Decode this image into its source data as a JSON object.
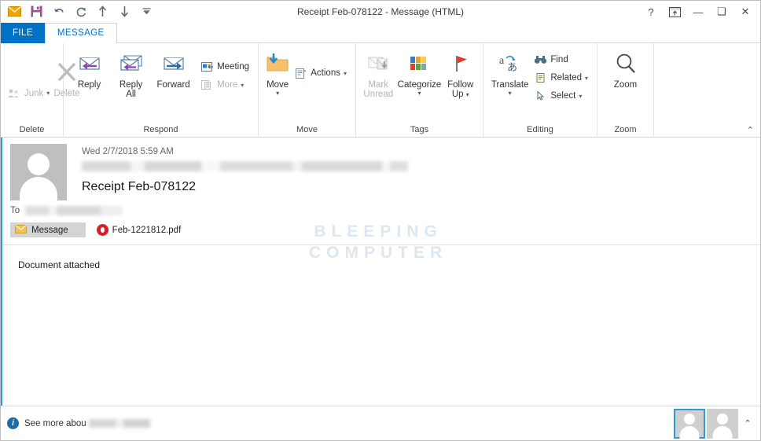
{
  "window": {
    "title": "Receipt Feb-078122 - Message (HTML)",
    "controls": {
      "help": "?",
      "ribbon_display_options": "ribbon-options-icon",
      "minimize": "—",
      "maximize": "❑",
      "close": "✕"
    }
  },
  "quick_access_toolbar": {
    "items": [
      {
        "name": "mail-icon",
        "label": "Mail"
      },
      {
        "name": "save-icon",
        "label": "Save"
      },
      {
        "name": "undo-icon",
        "label": "Undo"
      },
      {
        "name": "redo-icon",
        "label": "Redo"
      },
      {
        "name": "previous-item-icon",
        "label": "Previous Item"
      },
      {
        "name": "next-item-icon",
        "label": "Next Item"
      },
      {
        "name": "customize-qat-icon",
        "label": "Customize Quick Access Toolbar"
      }
    ]
  },
  "tabs": [
    {
      "id": "file",
      "label": "FILE",
      "active": false
    },
    {
      "id": "message",
      "label": "MESSAGE",
      "active": true
    }
  ],
  "ribbon": {
    "collapse_label": "⌃",
    "groups": [
      {
        "id": "delete",
        "label": "Delete",
        "small_buttons": [
          {
            "id": "junk",
            "label": "Junk",
            "caret": "▾",
            "disabled": true
          }
        ],
        "big_buttons": [
          {
            "id": "delete",
            "label": "Delete",
            "disabled": true
          }
        ]
      },
      {
        "id": "respond",
        "label": "Respond",
        "big_buttons": [
          {
            "id": "reply",
            "label": "Reply",
            "disabled": false
          },
          {
            "id": "reply-all",
            "label": "Reply\nAll",
            "line1": "Reply",
            "line2": "All",
            "disabled": false
          },
          {
            "id": "forward",
            "label": "Forward",
            "disabled": false
          }
        ],
        "small_buttons": [
          {
            "id": "meeting",
            "label": "Meeting",
            "caret": "",
            "disabled": false
          },
          {
            "id": "more",
            "label": "More",
            "caret": "▾",
            "disabled": true
          }
        ]
      },
      {
        "id": "move",
        "label": "Move",
        "big_buttons": [
          {
            "id": "move",
            "label": "Move",
            "caret": "▾",
            "disabled": false
          }
        ],
        "small_buttons": [
          {
            "id": "actions",
            "label": "Actions",
            "caret": "▾",
            "disabled": false
          }
        ]
      },
      {
        "id": "tags",
        "label": "Tags",
        "dialog_launcher": "⌐",
        "big_buttons": [
          {
            "id": "mark-unread",
            "line1": "Mark",
            "line2": "Unread",
            "label": "Mark Unread",
            "disabled": true
          },
          {
            "id": "categorize",
            "label": "Categorize",
            "caret": "▾",
            "disabled": false
          },
          {
            "id": "follow-up",
            "line1": "Follow",
            "line2": "Up",
            "label": "Follow Up",
            "caret": "▾",
            "disabled": false
          }
        ]
      },
      {
        "id": "editing",
        "label": "Editing",
        "big_buttons": [
          {
            "id": "translate",
            "label": "Translate",
            "caret": "▾",
            "disabled": false
          }
        ],
        "small_buttons": [
          {
            "id": "find",
            "label": "Find",
            "caret": "",
            "disabled": false
          },
          {
            "id": "related",
            "label": "Related",
            "caret": "▾",
            "disabled": false
          },
          {
            "id": "select",
            "label": "Select",
            "caret": "▾",
            "disabled": false
          }
        ]
      },
      {
        "id": "zoom",
        "label": "Zoom",
        "big_buttons": [
          {
            "id": "zoom",
            "label": "Zoom",
            "disabled": false
          }
        ]
      }
    ]
  },
  "message": {
    "date": "Wed 2/7/2018 5:59 AM",
    "sender": "",
    "subject": "Receipt Feb-078122",
    "to_label": "To",
    "to_value": "",
    "message_tab_label": "Message",
    "attachment": {
      "filename": "Feb-1221812.pdf",
      "icon": "pdf-icon"
    },
    "body": "Document attached"
  },
  "watermark": {
    "line1": "BLEEPING",
    "line2": "COMPUTER"
  },
  "status_bar": {
    "see_more_label": "See more abou",
    "info_icon": "i",
    "people_pane": {
      "collapse": "⌃",
      "contacts": [
        {
          "id": "contact-1",
          "selected": true
        },
        {
          "id": "contact-2",
          "selected": false
        }
      ]
    }
  },
  "colors": {
    "file_tab": "#0072c6",
    "accent_bar": "#2e9bd6",
    "pdf_red": "#d6202a",
    "watermark": "#dde7f0"
  }
}
